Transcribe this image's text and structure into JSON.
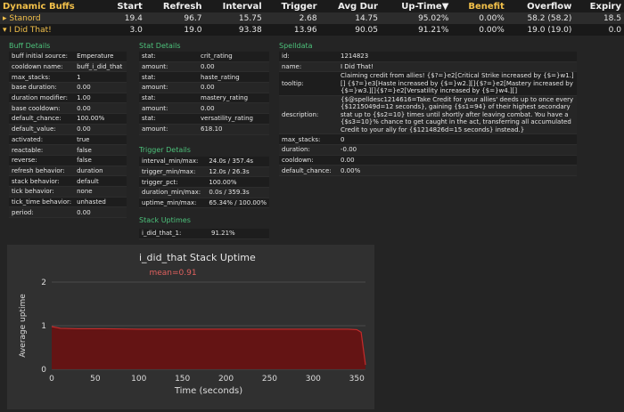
{
  "buffs_table": {
    "headers": [
      "Dynamic Buffs",
      "Start",
      "Refresh",
      "Interval",
      "Trigger",
      "Avg Dur",
      "Up-Time▼",
      "Benefit",
      "Overflow",
      "Expiry"
    ],
    "rows": [
      {
        "name": "▸ Stanord",
        "cells": [
          "19.4",
          "96.7",
          "15.75",
          "2.68",
          "14.75",
          "95.02%",
          "0.00%",
          "58.2 (58.2)",
          "18.5"
        ]
      },
      {
        "name": "▾ I Did That!",
        "cells": [
          "3.0",
          "19.0",
          "93.38",
          "13.96",
          "90.05",
          "91.21%",
          "0.00%",
          "19.0 (19.0)",
          "0.0"
        ]
      }
    ]
  },
  "buff_details": {
    "title": "Buff Details",
    "rows": [
      [
        "buff initial source:",
        "Emperature"
      ],
      [
        "cooldown name:",
        "buff_i_did_that"
      ],
      [
        "max_stacks:",
        "1"
      ],
      [
        "base duration:",
        "0.00"
      ],
      [
        "duration modifier:",
        "1.00"
      ],
      [
        "base cooldown:",
        "0.00"
      ],
      [
        "default_chance:",
        "100.00%"
      ],
      [
        "default_value:",
        "0.00"
      ],
      [
        "activated:",
        "true"
      ],
      [
        "reactable:",
        "false"
      ],
      [
        "reverse:",
        "false"
      ],
      [
        "refresh behavior:",
        "duration"
      ],
      [
        "stack behavior:",
        "default"
      ],
      [
        "tick behavior:",
        "none"
      ],
      [
        "tick_time behavior:",
        "unhasted"
      ],
      [
        "period:",
        "0.00"
      ]
    ]
  },
  "stat_details": {
    "title": "Stat Details",
    "rows": [
      [
        "stat:",
        "crit_rating"
      ],
      [
        "amount:",
        "0.00"
      ],
      [
        "stat:",
        "haste_rating"
      ],
      [
        "amount:",
        "0.00"
      ],
      [
        "stat:",
        "mastery_rating"
      ],
      [
        "amount:",
        "0.00"
      ],
      [
        "stat:",
        "versatility_rating"
      ],
      [
        "amount:",
        "618.10"
      ]
    ]
  },
  "trigger_details": {
    "title": "Trigger Details",
    "rows": [
      [
        "interval_min/max:",
        "24.0s / 357.4s"
      ],
      [
        "trigger_min/max:",
        "12.0s / 26.3s"
      ],
      [
        "trigger_pct:",
        "100.00%"
      ],
      [
        "duration_min/max:",
        "0.0s / 359.3s"
      ],
      [
        "uptime_min/max:",
        "65.34% / 100.00%"
      ]
    ]
  },
  "stack_uptimes": {
    "title": "Stack Uptimes",
    "rows": [
      [
        "i_did_that_1:",
        "91.21%"
      ]
    ]
  },
  "spelldata": {
    "title": "Spelldata",
    "rows": [
      [
        "id:",
        "1214823"
      ],
      [
        "name:",
        "I Did That!"
      ],
      [
        "tooltip:",
        "Claiming credit from allies! {$?=}e2[Critical Strike increased by {$=}w1.][] {$?=}e3[Haste increased by {$=}w2.][]{$?=}e2[Mastery increased by {$=}w3.][]{$?=}e2[Versatility increased by {$=}w4.][]"
      ],
      [
        "description:",
        "{$@spelldesc1214616=Take Credit for your allies' deeds up to once every {$1215049d=12 seconds}, gaining {$s1=94} of their highest secondary stat up to {$s2=10} times until shortly after leaving combat. You have a {$s3=10}% chance to get caught in the act, transferring all accumulated Credit to your ally for {$1214826d=15 seconds} instead.}"
      ],
      [
        "max_stacks:",
        "0"
      ],
      [
        "duration:",
        "-0.00"
      ],
      [
        "cooldown:",
        "0.00"
      ],
      [
        "default_chance:",
        "0.00%"
      ]
    ]
  },
  "colors": {
    "accent_orange": "#f2c04a",
    "section_green": "#4cc07a",
    "uptime_fill": "#6a1212",
    "uptime_line": "#c52a2a",
    "mean_text": "#e0605e"
  },
  "chart_data": {
    "type": "area",
    "title": "i_did_that Stack Uptime",
    "xlabel": "Time (seconds)",
    "ylabel": "Average uptime",
    "xlim": [
      0,
      360
    ],
    "ylim": [
      0,
      2
    ],
    "xticks": [
      0,
      50,
      100,
      150,
      200,
      250,
      300,
      350
    ],
    "yticks": [
      0,
      1,
      2
    ],
    "annotation": "mean=0.91",
    "grid": true,
    "x": [
      0,
      5,
      10,
      30,
      60,
      100,
      150,
      200,
      250,
      300,
      340,
      350,
      355,
      360
    ],
    "series": [
      {
        "values": [
          0.98,
          0.96,
          0.94,
          0.93,
          0.93,
          0.92,
          0.92,
          0.92,
          0.92,
          0.92,
          0.92,
          0.91,
          0.85,
          0.1
        ]
      }
    ]
  }
}
